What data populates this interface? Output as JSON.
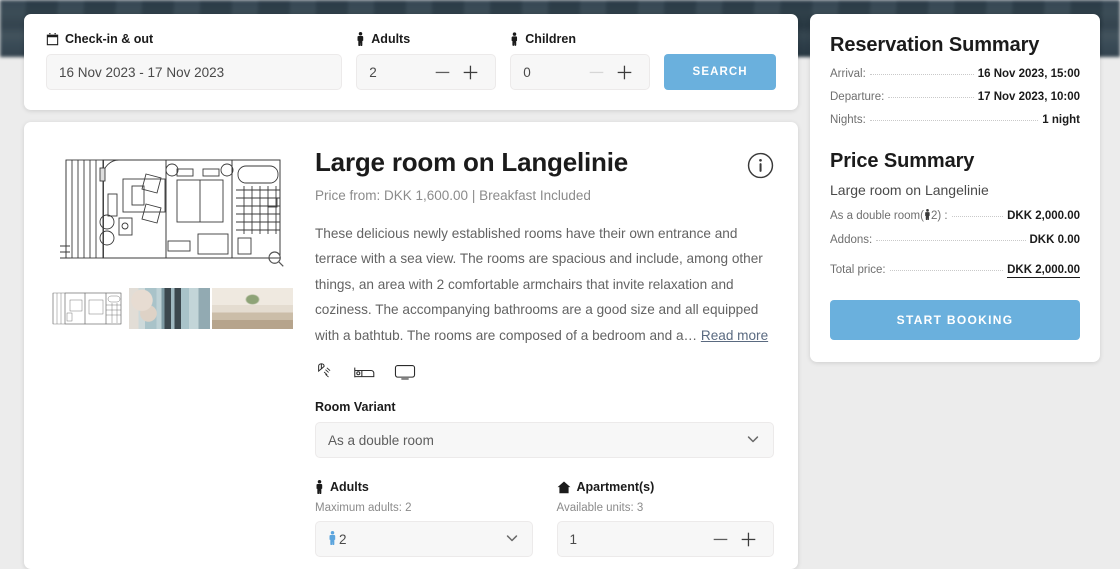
{
  "search": {
    "checkin_label": "Check-in & out",
    "checkin_icon": "calendar-icon",
    "date_value": "16 Nov 2023 - 17 Nov 2023",
    "adults_label": "Adults",
    "adults_icon": "person-icon",
    "adults_value": "2",
    "children_label": "Children",
    "children_icon": "child-icon",
    "children_value": "0",
    "search_button": "SEARCH",
    "minus_icon": "minus-icon",
    "plus_icon": "plus-icon"
  },
  "room": {
    "title": "Large room on Langelinie",
    "info_icon": "info-circle-icon",
    "price_line": "Price from: DKK 1,600.00 | Breakfast Included",
    "description": "These delicious newly established rooms have their own entrance and terrace with a sea view. The rooms are spacious and include, among other things, an area with 2 comfortable armchairs that invite relaxation and coziness. The accompanying bathrooms are a good size and all equipped with a bathtub. The rooms are composed of a bedroom and a…",
    "read_more": "Read more",
    "zoom_icon": "magnifier-icon",
    "amenities": [
      {
        "icon": "shower-icon",
        "label": "Shower"
      },
      {
        "icon": "bed-icon",
        "label": "Bed"
      },
      {
        "icon": "tv-icon",
        "label": "TV"
      }
    ],
    "thumbnails": [
      {
        "name": "floorplan-thumbnail"
      },
      {
        "name": "cabinet-photo-thumbnail"
      },
      {
        "name": "dining-photo-thumbnail"
      }
    ],
    "variant_label": "Room Variant",
    "variant_value": "As a double room",
    "chevron_icon": "chevron-down-icon",
    "adults_label": "Adults",
    "adults_icon": "person-icon",
    "adults_max": "Maximum adults: 2",
    "adults_value": "2",
    "adults_value_icon": "person-icon",
    "apartments_label": "Apartment(s)",
    "apartments_icon": "home-icon",
    "apartments_available": "Available units: 3",
    "apartments_value": "1"
  },
  "summary": {
    "title": "Reservation Summary",
    "rows": [
      {
        "label": "Arrival:",
        "value": "16 Nov 2023, 15:00"
      },
      {
        "label": "Departure:",
        "value": "17 Nov 2023, 10:00"
      },
      {
        "label": "Nights:",
        "value": "1 night"
      }
    ],
    "price_title": "Price Summary",
    "room_name": "Large room on Langelinie",
    "price_rows": [
      {
        "label_pre": "As a double room(",
        "label_icon": "person-icon",
        "label_post": "2) :",
        "value": "DKK 2,000.00"
      },
      {
        "label_pre": "Addons:",
        "label_icon": "",
        "label_post": "",
        "value": "DKK 0.00"
      }
    ],
    "total_label": "Total price:",
    "total_value": "DKK 2,000.00",
    "start_booking": "START BOOKING"
  },
  "colors": {
    "accent": "#6ab0dd",
    "page_bg": "#ececec",
    "hero": "#2d3f4d"
  }
}
